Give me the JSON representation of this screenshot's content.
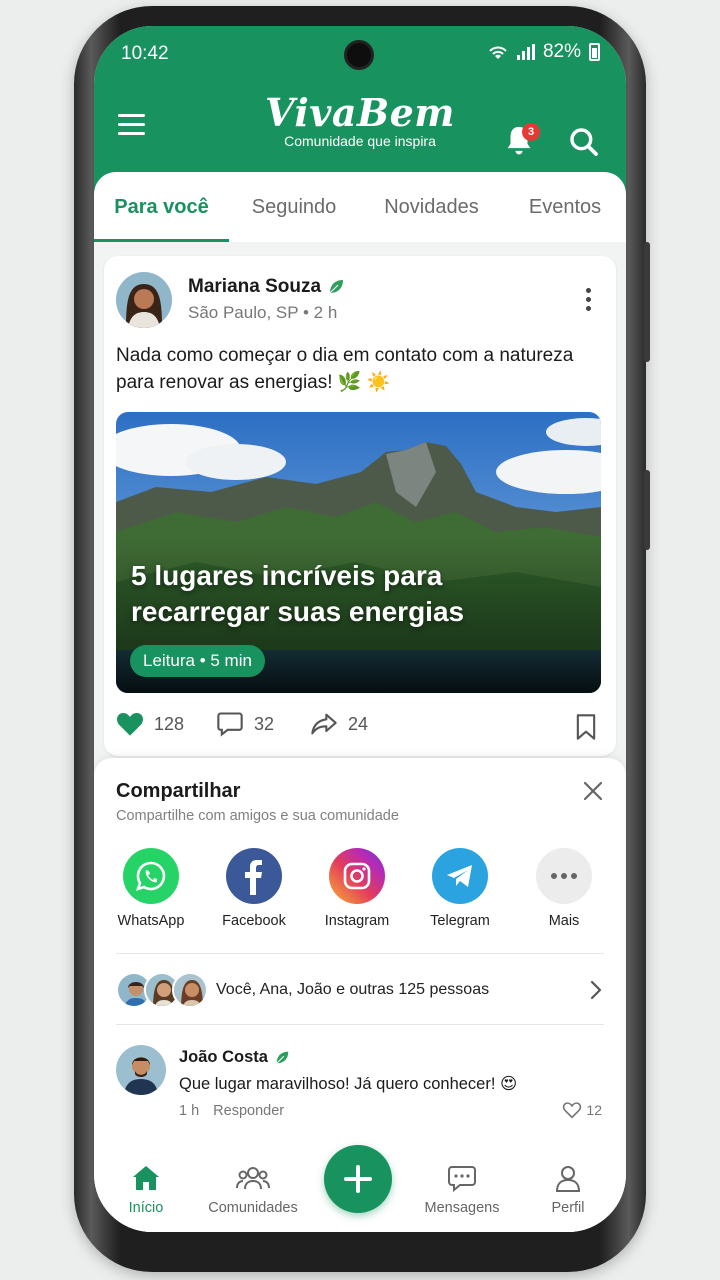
{
  "status_bar": {
    "time": "10:42",
    "battery": "82%"
  },
  "app": {
    "name": "VivaBem",
    "tagline": "Comunidade que inspira",
    "notification_count": "3"
  },
  "tabs": [
    {
      "label": "Para você",
      "active": true
    },
    {
      "label": "Seguindo",
      "active": false
    },
    {
      "label": "Novidades",
      "active": false
    },
    {
      "label": "Eventos",
      "active": false
    }
  ],
  "post": {
    "author": "Mariana Souza",
    "meta": "São Paulo, SP • 2 h",
    "text": "Nada como começar o dia em contato com a natureza para renovar as energias! 🌿 ☀️",
    "article_title": "5 lugares incríveis para recarregar suas energias",
    "article_pill": "Leitura • 5 min",
    "likes": "128",
    "comments": "32",
    "shares": "24"
  },
  "share_sheet": {
    "title": "Compartilhar",
    "subtitle": "Compartilhe com amigos e sua comunidade",
    "targets": [
      {
        "label": "WhatsApp",
        "icon": "whatsapp-icon",
        "color": "#25d366"
      },
      {
        "label": "Facebook",
        "icon": "facebook-icon",
        "color": "#3b5998"
      },
      {
        "label": "Instagram",
        "icon": "instagram-icon",
        "color": "#d6249f"
      },
      {
        "label": "Telegram",
        "icon": "telegram-icon",
        "color": "#2aa3e0"
      },
      {
        "label": "Mais",
        "icon": "more-icon",
        "color": "#ececec"
      }
    ],
    "people_text": "Você, Ana, João e outras 125 pessoas"
  },
  "comment": {
    "author": "João Costa",
    "text": "Que lugar maravilhoso! Já quero conhecer! 😍",
    "time": "1 h",
    "reply_label": "Responder",
    "likes": "12"
  },
  "bottom_nav": [
    {
      "label": "Início",
      "icon": "home-icon",
      "active": true
    },
    {
      "label": "Comunidades",
      "icon": "communities-icon",
      "active": false
    },
    {
      "label": "Mensagens",
      "icon": "messages-icon",
      "active": false
    },
    {
      "label": "Perfil",
      "icon": "profile-icon",
      "active": false
    }
  ],
  "colors": {
    "brand_green": "#18925f",
    "badge_red": "#e53935"
  }
}
